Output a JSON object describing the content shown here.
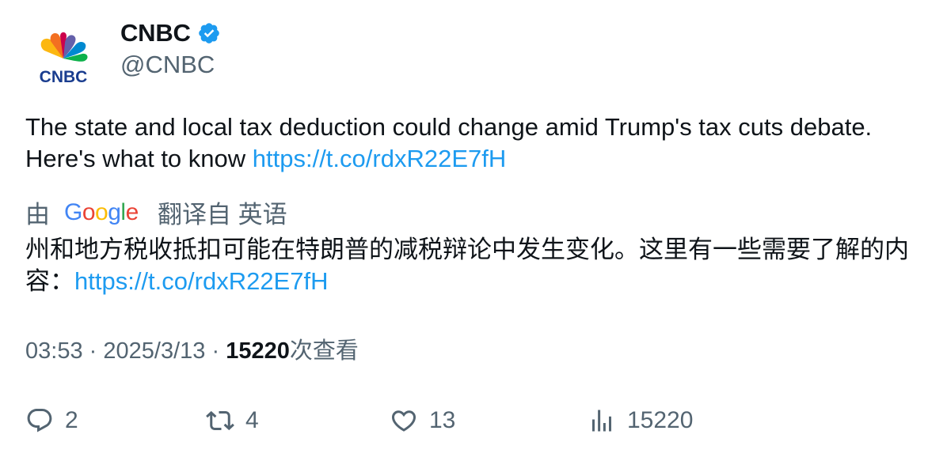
{
  "author": {
    "display_name": "CNBC",
    "handle": "@CNBC",
    "logo_text": "CNBC",
    "verified_color": "#1d9bf0"
  },
  "tweet": {
    "text_main": "The state and local tax deduction could change amid Trump's tax cuts debate. Here's what to know ",
    "link": "https://t.co/rdxR22E7fH"
  },
  "translation": {
    "prefix": "由",
    "provider": "Google",
    "suffix": "翻译自 英语",
    "text_main": "州和地方税收抵扣可能在特朗普的减税辩论中发生变化。这里有一些需要了解的内容：",
    "link": "https://t.co/rdxR22E7fH"
  },
  "meta": {
    "time": "03:53",
    "separator": "·",
    "date": "2025/3/13",
    "views_count": "15220",
    "views_label": "次查看"
  },
  "actions": {
    "replies": "2",
    "retweets": "4",
    "likes": "13",
    "views": "15220"
  },
  "icons": {
    "reply": "reply-icon",
    "retweet": "retweet-icon",
    "like": "heart-icon",
    "views": "analytics-icon",
    "verified": "verified-badge-icon"
  },
  "colors": {
    "link": "#1d9bf0",
    "secondary": "#536471",
    "primary": "#0f1419"
  }
}
